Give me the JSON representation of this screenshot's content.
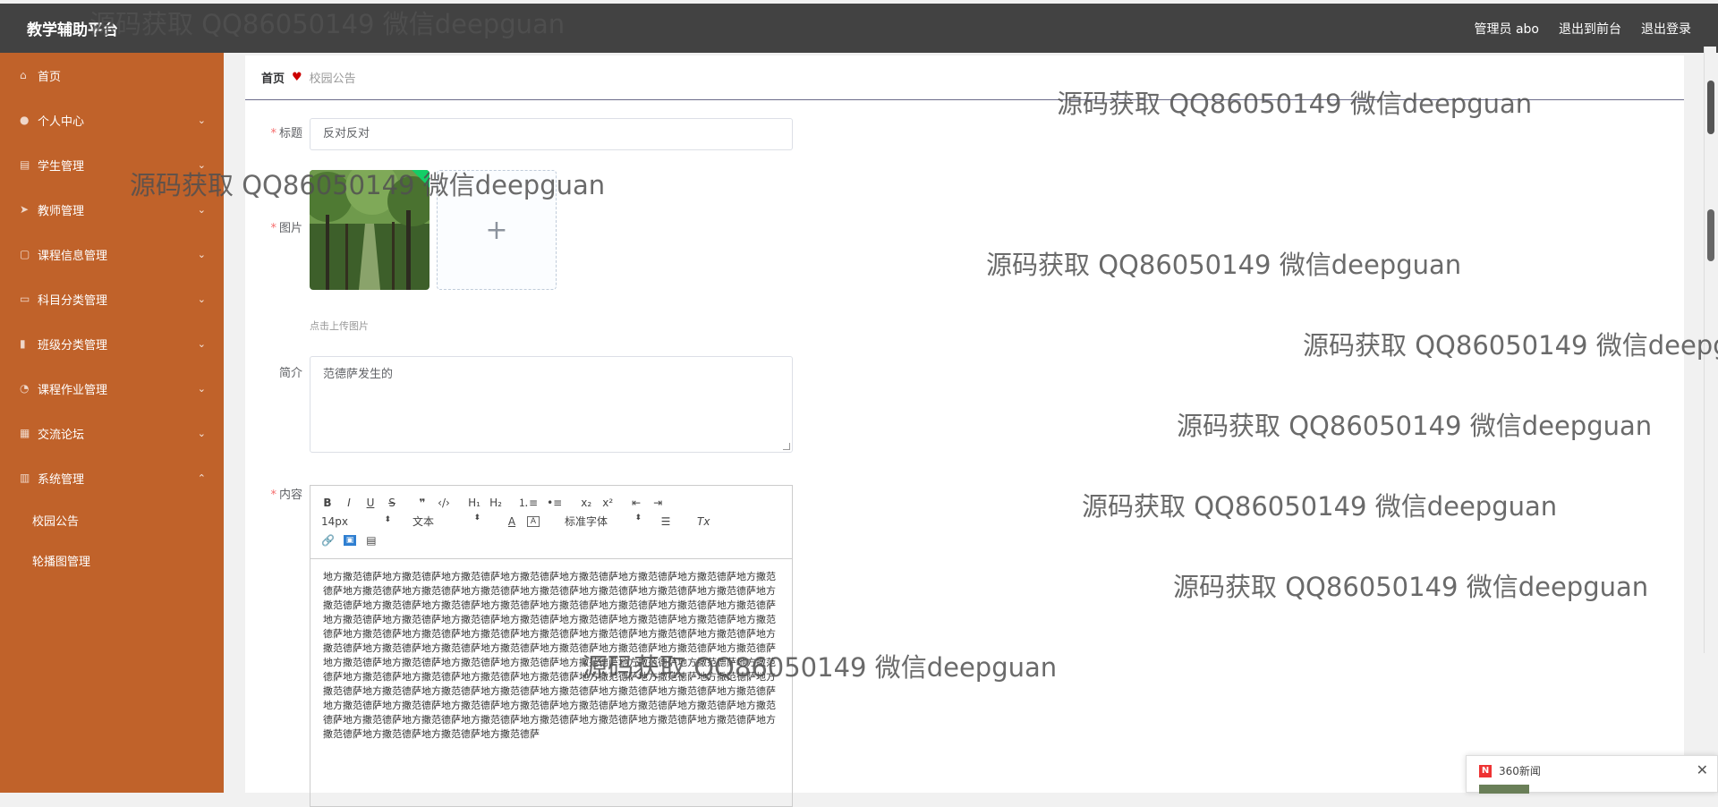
{
  "header": {
    "app_title": "教学辅助平台",
    "admin_label": "管理员 abo",
    "to_front_label": "退出到前台",
    "logout_label": "退出登录"
  },
  "sidebar": {
    "items": [
      {
        "label": "首页",
        "icon": "home-icon"
      },
      {
        "label": "个人中心",
        "icon": "user-icon"
      },
      {
        "label": "学生管理",
        "icon": "clipboard-icon"
      },
      {
        "label": "教师管理",
        "icon": "send-icon"
      },
      {
        "label": "课程信息管理",
        "icon": "square-icon"
      },
      {
        "label": "科目分类管理",
        "icon": "chat-icon"
      },
      {
        "label": "班级分类管理",
        "icon": "bar-chart-icon"
      },
      {
        "label": "课程作业管理",
        "icon": "circle-icon"
      },
      {
        "label": "交流论坛",
        "icon": "grid-icon"
      },
      {
        "label": "系统管理",
        "icon": "stack-icon"
      }
    ],
    "sub_items": [
      {
        "label": "校园公告"
      },
      {
        "label": "轮播图管理"
      }
    ]
  },
  "breadcrumb": {
    "home": "首页",
    "current": "校园公告"
  },
  "form": {
    "title_label": "标题",
    "title_value": "反对反对",
    "image_label": "图片",
    "upload_hint": "点击上传图片",
    "intro_label": "简介",
    "intro_value": "范德萨发生的",
    "content_label": "内容",
    "editor": {
      "font_size": "14px",
      "block_format": "文本",
      "font_family": "标准字体",
      "body_text": "地方撒范德萨地方撒范德萨地方撒范德萨地方撒范德萨地方撒范德萨地方撒范德萨地方撒范德萨地方撒范德萨地方撒范德萨地方撒范德萨地方撒范德萨地方撒范德萨地方撒范德萨地方撒范德萨地方撒范德萨地方撒范德萨地方撒范德萨地方撒范德萨地方撒范德萨地方撒范德萨地方撒范德萨地方撒范德萨地方撒范德萨地方撒范德萨地方撒范德萨地方撒范德萨地方撒范德萨地方撒范德萨地方撒范德萨地方撒范德萨地方撒范德萨地方撒范德萨地方撒范德萨地方撒范德萨地方撒范德萨地方撒范德萨地方撒范德萨地方撒范德萨地方撒范德萨地方撒范德萨地方撒范德萨地方撒范德萨地方撒范德萨地方撒范德萨地方撒范德萨地方撒范德萨地方撒范德萨地方撒范德萨地方撒范德萨地方撒范德萨地方撒范德萨地方撒范德萨地方撒范德萨地方撒范德萨地方撒范德萨地方撒范德萨地方撒范德萨地方撒范德萨地方撒范德萨地方撒范德萨地方撒范德萨地方撒范德萨地方撒范德萨地方撒范德萨地方撒范德萨地方撒范德萨地方撒范德萨地方撒范德萨地方撒范德萨地方撒范德萨地方撒范德萨地方撒范德萨地方撒范德萨地方撒范德萨地方撒范德萨地方撒范德萨地方撒范德萨地方撒范德萨地方撒范德萨地方撒范德萨地方撒范德萨地方撒范德萨地方撒范德萨地方撒范德萨地方撒范德萨地方撒范德萨地方撒范德萨地方撒范德萨"
    }
  },
  "news_popup": {
    "title": "360新闻",
    "logo_letter": "N"
  },
  "watermark_text": "源码获取 QQ86050149 微信deepguan",
  "colors": {
    "topbar": "#424242",
    "sidebar": "#c0622a",
    "required": "#f56c6c"
  }
}
